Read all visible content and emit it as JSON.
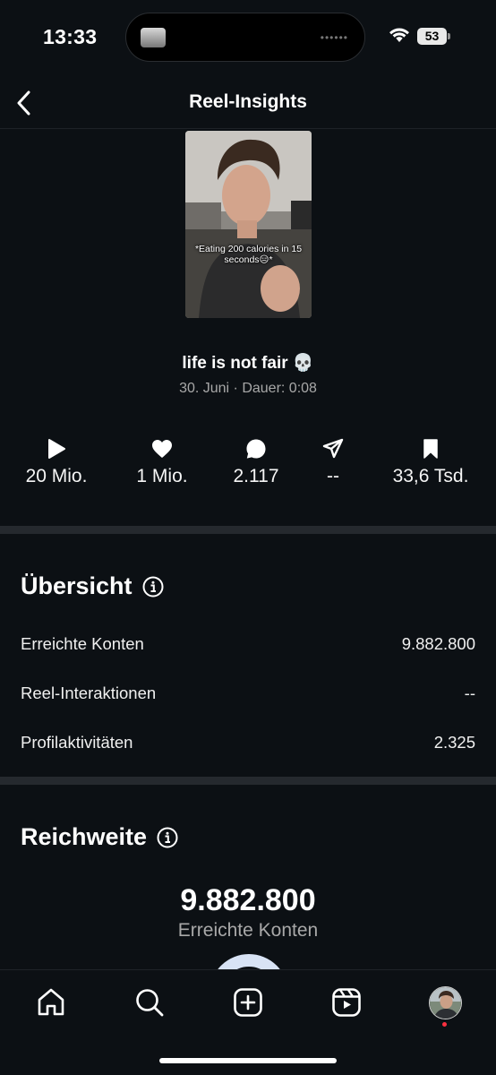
{
  "status_bar": {
    "time": "13:33",
    "battery": "53",
    "icons": [
      "wifi-icon",
      "battery-icon"
    ],
    "island_dots": "••••••"
  },
  "header": {
    "title": "Reel-Insights",
    "back_icon": "chevron-left-icon"
  },
  "reel": {
    "overlay_caption": "*Eating 200 calories in 15 seconds😑*",
    "title": "life is not fair 💀",
    "meta": "30. Juni · Dauer: 0:08"
  },
  "stats": [
    {
      "icon": "play-icon",
      "value": "20 Mio."
    },
    {
      "icon": "heart-icon",
      "value": "1 Mio."
    },
    {
      "icon": "comment-icon",
      "value": "2.117"
    },
    {
      "icon": "share-icon",
      "value": "--"
    },
    {
      "icon": "bookmark-icon",
      "value": "33,6 Tsd."
    }
  ],
  "overview": {
    "title": "Übersicht",
    "rows": [
      {
        "label": "Erreichte Konten",
        "value": "9.882.800"
      },
      {
        "label": "Reel-Interaktionen",
        "value": "--"
      },
      {
        "label": "Profilaktivitäten",
        "value": "2.325"
      }
    ]
  },
  "reach": {
    "title": "Reichweite",
    "number": "9.882.800",
    "label": "Erreichte Konten"
  },
  "bottom_nav": {
    "items": [
      "home-icon",
      "search-icon",
      "create-icon",
      "reels-icon",
      "profile-avatar"
    ],
    "colors": {
      "accent": "#ff3040",
      "background": "#0c1014",
      "divider": "#25292e"
    }
  }
}
